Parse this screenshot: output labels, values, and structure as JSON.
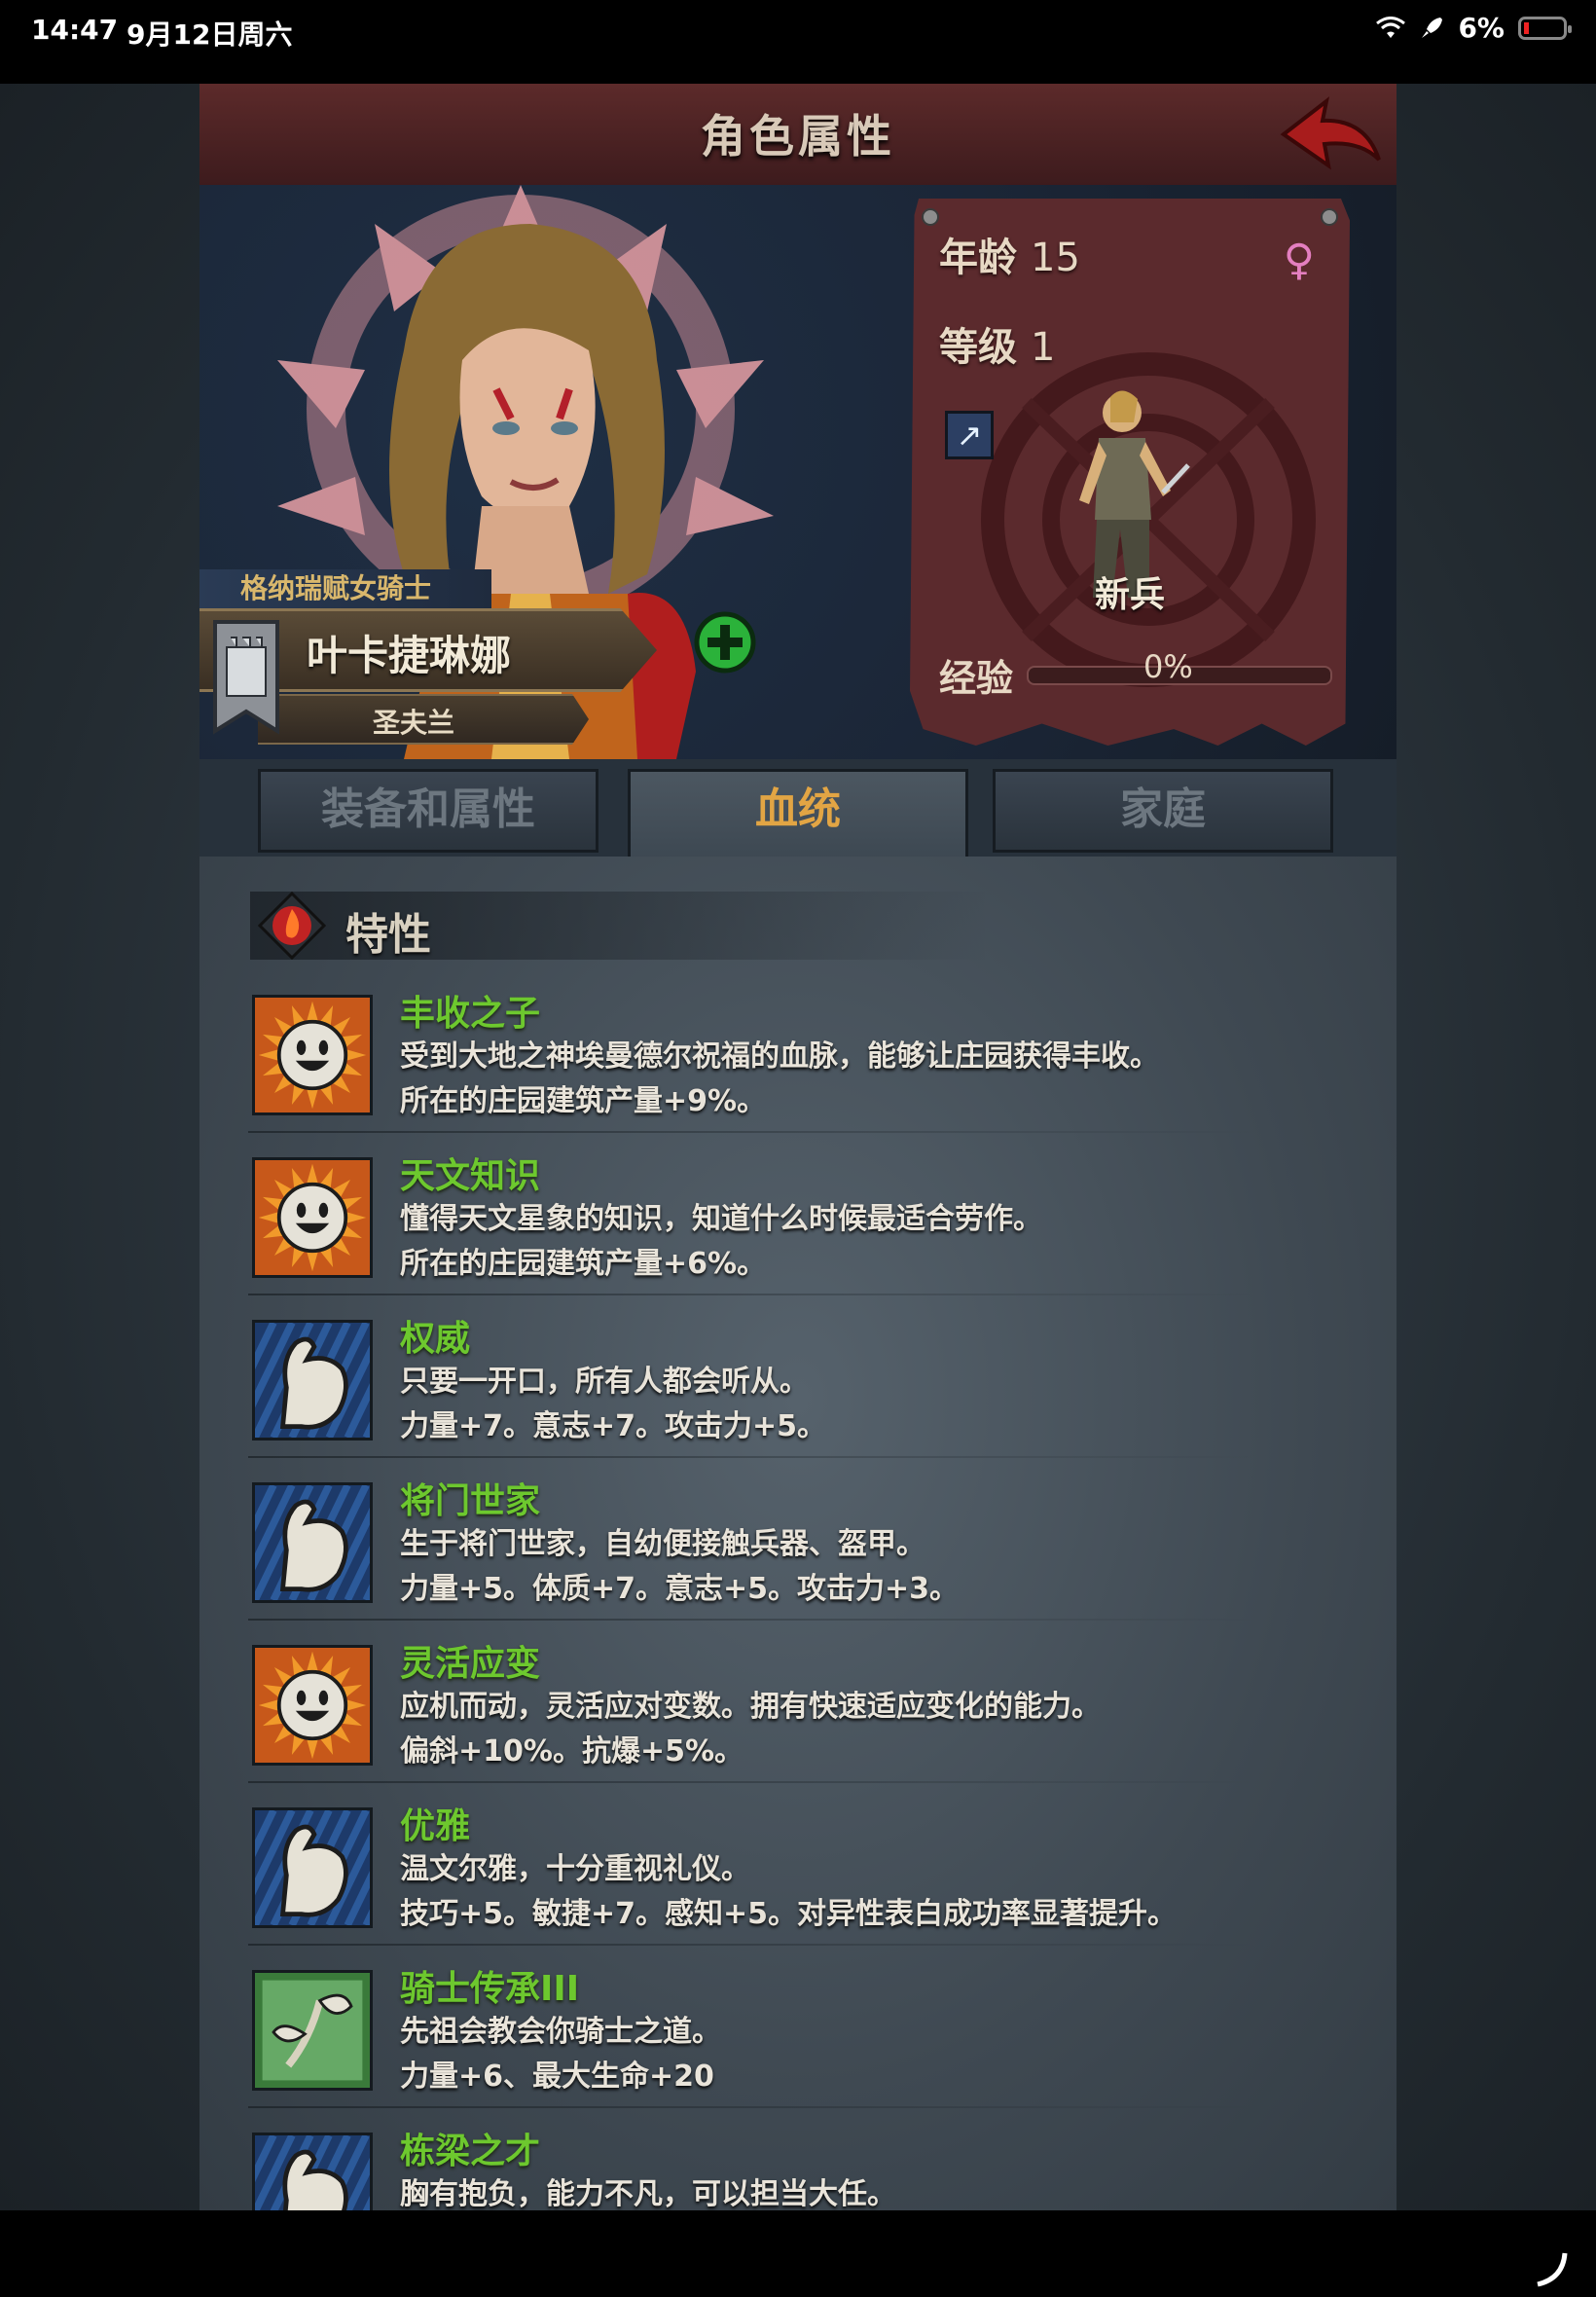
{
  "status_bar": {
    "time": "14:47",
    "date": "9月12日周六",
    "battery": "6%"
  },
  "header": {
    "title": "角色属性",
    "back_icon": "back-arrow-icon"
  },
  "character": {
    "title": "格纳瑞赋女骑士",
    "name": "叶卡捷琳娜",
    "place": "圣夫兰",
    "age_label": "年龄",
    "age": "15",
    "level_label": "等级",
    "level": "1",
    "rank": "新兵",
    "exp_label": "经验",
    "exp": "0%",
    "exp_fraction": 0
  },
  "tabs": [
    {
      "label": "装备和属性",
      "active": false
    },
    {
      "label": "血统",
      "active": true
    },
    {
      "label": "家庭",
      "active": false
    }
  ],
  "section": {
    "title": "特性",
    "icon": "fire-icon"
  },
  "traits": [
    {
      "name": "丰收之子",
      "desc": "受到大地之神埃曼德尔祝福的血脉，能够让庄园获得丰收。",
      "effect": "所在的庄园建筑产量+9%。",
      "icon": "sun-smile-icon"
    },
    {
      "name": "天文知识",
      "desc": "懂得天文星象的知识，知道什么时候最适合劳作。",
      "effect": "所在的庄园建筑产量+6%。",
      "icon": "sun-smile-icon"
    },
    {
      "name": "权威",
      "desc": "只要一开口，所有人都会听从。",
      "effect": "力量+7。意志+7。攻击力+5。",
      "icon": "flexed-arm-icon"
    },
    {
      "name": "将门世家",
      "desc": "生于将门世家，自幼便接触兵器、盔甲。",
      "effect": "力量+5。体质+7。意志+5。攻击力+3。",
      "icon": "flexed-arm-icon"
    },
    {
      "name": "灵活应变",
      "desc": "应机而动，灵活应对变数。拥有快速适应变化的能力。",
      "effect": "偏斜+10%。抗爆+5%。",
      "icon": "sun-smile-icon"
    },
    {
      "name": "优雅",
      "desc": "温文尔雅，十分重视礼仪。",
      "effect": "技巧+5。敏捷+7。感知+5。对异性表白成功率显著提升。",
      "icon": "flexed-arm-icon"
    },
    {
      "name": "骑士传承III",
      "desc": "先祖会教会你骑士之道。",
      "effect": "力量+6、最大生命+20",
      "icon": "sprout-icon"
    },
    {
      "name": "栋梁之才",
      "desc": "胸有抱负，能力不凡，可以担当大任。",
      "effect": "",
      "icon": "flexed-arm-icon"
    }
  ]
}
